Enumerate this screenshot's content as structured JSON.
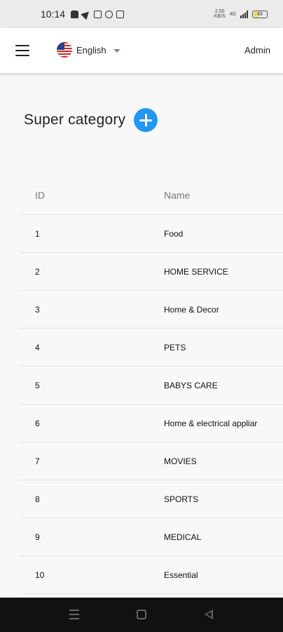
{
  "status_bar": {
    "time": "10:14",
    "net_speed_top": "2.00",
    "net_speed_bottom": "KB/S",
    "network_type": "4G",
    "battery": "49"
  },
  "app_bar": {
    "language": "English",
    "user": "Admin"
  },
  "page": {
    "title": "Super category"
  },
  "table": {
    "columns": [
      "ID",
      "Name"
    ],
    "rows": [
      {
        "id": "1",
        "name": "Food"
      },
      {
        "id": "2",
        "name": "HOME SERVICE"
      },
      {
        "id": "3",
        "name": "Home & Decor"
      },
      {
        "id": "4",
        "name": "PETS"
      },
      {
        "id": "5",
        "name": "BABYS CARE"
      },
      {
        "id": "6",
        "name": "Home & electrical appliar"
      },
      {
        "id": "7",
        "name": "MOVIES"
      },
      {
        "id": "8",
        "name": "SPORTS"
      },
      {
        "id": "9",
        "name": "MEDICAL"
      },
      {
        "id": "10",
        "name": "Essential"
      }
    ]
  },
  "colors": {
    "accent": "#2196f3",
    "page_background": "#f8f8f8",
    "app_bar_background": "#ffffff",
    "nav_bar_background": "#111111"
  }
}
